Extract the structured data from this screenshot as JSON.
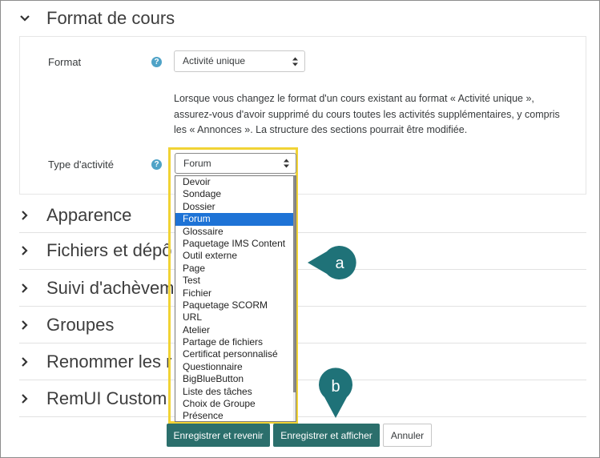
{
  "sections": {
    "format_cours": "Format de cours",
    "apparence": "Apparence",
    "fichiers": "Fichiers et dépô",
    "suivi": "Suivi d'achèvem",
    "groupes": "Groupes",
    "renommer": "Renommer les r",
    "remui": "RemUI Custom"
  },
  "form": {
    "format_label": "Format",
    "format_value": "Activité unique",
    "description": "Lorsque vous changez le format d'un cours existant au format « Activité unique », assurez-vous d'avoir supprimé du cours toutes les activités supplémentaires, y compris les « Annonces ». La structure des sections pourrait être modifiée.",
    "type_label": "Type d'activité",
    "type_value": "Forum"
  },
  "dropdown": {
    "options": [
      "Devoir",
      "Sondage",
      "Dossier",
      "Forum",
      "Glossaire",
      "Paquetage IMS Content",
      "Outil externe",
      "Page",
      "Test",
      "Fichier",
      "Paquetage SCORM",
      "URL",
      "Atelier",
      "Partage de fichiers",
      "Certificat personnalisé",
      "Questionnaire",
      "BigBlueButton",
      "Liste des tâches",
      "Choix de Groupe",
      "Présence"
    ],
    "selected": "Forum"
  },
  "buttons": {
    "save_return": "Enregistrer et revenir",
    "save_display": "Enregistrer et afficher",
    "cancel": "Annuler"
  },
  "callouts": {
    "a": "a",
    "b": "b"
  },
  "colors": {
    "accent": "#2b6f6c",
    "callout": "#1f7278",
    "highlight": "#f1d335",
    "selected": "#1e73d6",
    "help": "#4fa3c7"
  },
  "icons": {
    "expanded": "chevron-down-icon",
    "collapsed": "chevron-right-icon",
    "help": "question-circle-icon",
    "select": "select-arrows-icon"
  }
}
